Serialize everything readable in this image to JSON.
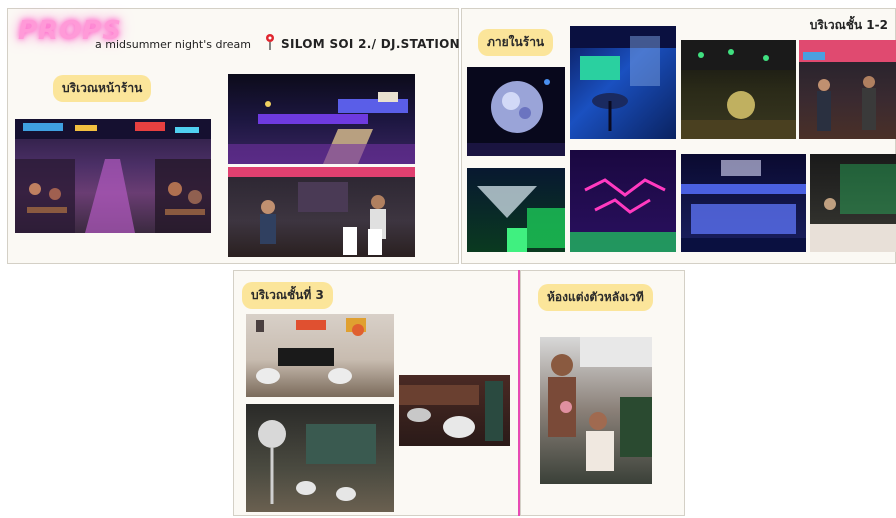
{
  "top_left": {
    "logo": "PROPS",
    "subtitle": "a midsummer night's dream",
    "location": "SILOM SOI 2./ DJ.STATION",
    "tag": "บริเวณหน้าร้าน"
  },
  "top_right": {
    "tag": "ภายในร้าน",
    "corner_label": "บริเวณชั้น 1-2"
  },
  "bottom_left": {
    "tag": "บริเวณชั้นที่ 3"
  },
  "bottom_right": {
    "tag": "ห้องแต่งตัวหลังเวที"
  },
  "colors": {
    "tag_bg": "#fbe59a",
    "logo_glow": "#ff77d0",
    "divider": "#e84bb4"
  },
  "icons": [
    "map-pin-icon"
  ]
}
